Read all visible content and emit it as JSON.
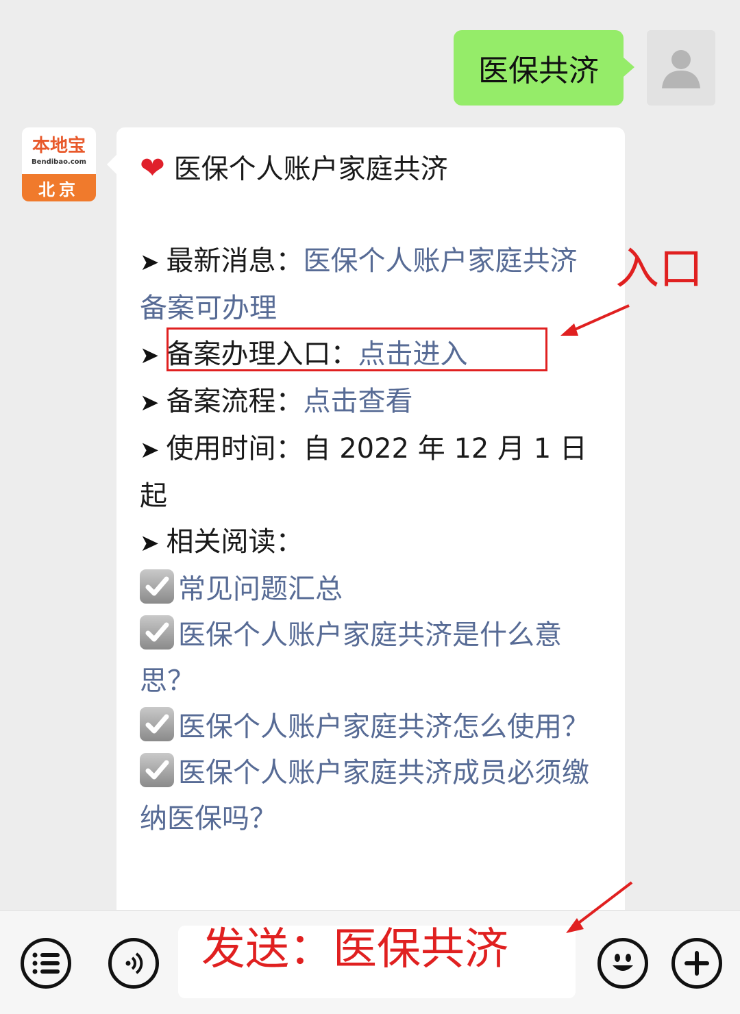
{
  "outgoing": {
    "text": "医保共济",
    "avatar_icon": "user-silhouette-icon"
  },
  "incoming": {
    "logo": {
      "name": "本地宝",
      "domain": "Bendibao.com",
      "city": "北京"
    },
    "title_emoji": "heart-icon",
    "title": "医保个人账户家庭共济",
    "items": [
      {
        "label": "最新消息：",
        "link": "医保个人账户家庭共济备案可办理"
      },
      {
        "label": "备案办理入口：",
        "link": "点击进入"
      },
      {
        "label": "备案流程：",
        "link": "点击查看"
      },
      {
        "label": "使用时间：自 2022 年 12 月 1 日起"
      },
      {
        "label": "相关阅读："
      }
    ],
    "related": [
      "常见问题汇总",
      "医保个人账户家庭共济是什么意思？",
      "医保个人账户家庭共济怎么使用？",
      "医保个人账户家庭共济成员必须缴纳医保吗？"
    ]
  },
  "annotations": {
    "entry": "入口",
    "send": "发送：医保共济",
    "color": "#e02020"
  },
  "bottom_bar": {
    "menu_icon": "list-menu-icon",
    "voice_icon": "voice-icon",
    "emoji_icon": "emoji-icon",
    "add_icon": "add-icon"
  },
  "colors": {
    "outgoing_bubble": "#95ec69",
    "link": "#576b95",
    "background": "#ededed"
  }
}
